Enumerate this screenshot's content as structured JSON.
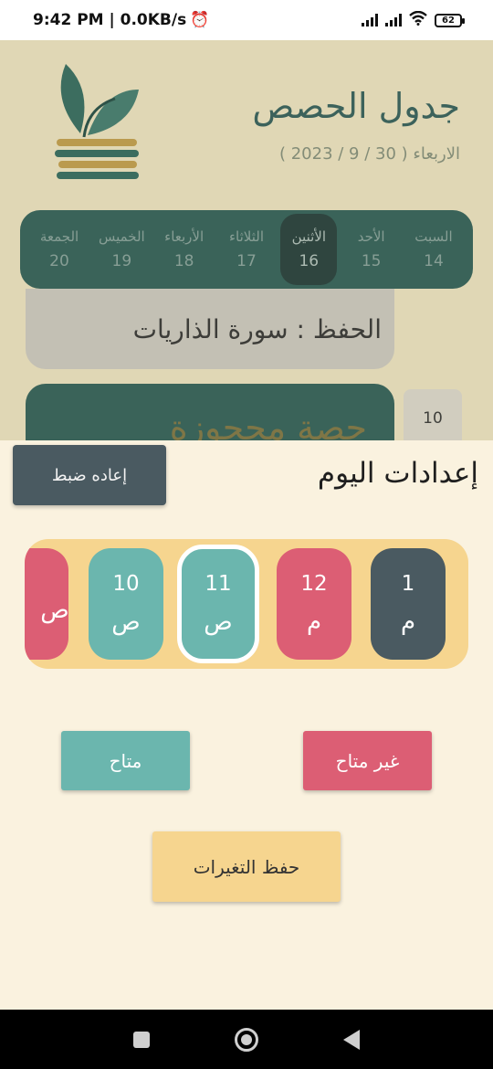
{
  "status_bar": {
    "time_speed": "9:42 PM | 0.0KB/s",
    "battery": "62",
    "icons": [
      "alarm-icon",
      "signal-icon",
      "signal-icon",
      "wifi-icon",
      "battery-icon"
    ]
  },
  "header": {
    "title": "جدول الحصص",
    "date": "الاربعاء ( 30 / 9 / 2023 )"
  },
  "days": [
    {
      "name": "السبت",
      "num": "14",
      "active": false
    },
    {
      "name": "الأحد",
      "num": "15",
      "active": false
    },
    {
      "name": "الأثنين",
      "num": "16",
      "active": true
    },
    {
      "name": "الثلاثاء",
      "num": "17",
      "active": false
    },
    {
      "name": "الأربعاء",
      "num": "18",
      "active": false
    },
    {
      "name": "الخميس",
      "num": "19",
      "active": false
    },
    {
      "name": "الجمعة",
      "num": "20",
      "active": false
    }
  ],
  "memorize_card": {
    "text": "الحفظ : سورة الذاريات"
  },
  "session_card": {
    "text": "حصة محجوزة",
    "hour": "10"
  },
  "sheet": {
    "title": "إعدادات اليوم",
    "reset_label": "إعاده ضبط",
    "hours": [
      {
        "hour": "1",
        "period": "م",
        "status": "slate"
      },
      {
        "hour": "12",
        "period": "م",
        "status": "red"
      },
      {
        "hour": "11",
        "period": "ص",
        "status": "teal",
        "selected": true
      },
      {
        "hour": "10",
        "period": "ص",
        "status": "teal"
      },
      {
        "hour": "",
        "period": "ص",
        "status": "red"
      }
    ],
    "available_label": "متاح",
    "unavailable_label": "غير متاح",
    "save_label": "حفظ التغيرات"
  },
  "colors": {
    "teal_dark": "#2d5e57",
    "teal": "#6bb6ae",
    "red": "#dc5e74",
    "slate": "#4a5a61",
    "yellow": "#f6d58f",
    "sheet_bg": "#faf2df"
  }
}
